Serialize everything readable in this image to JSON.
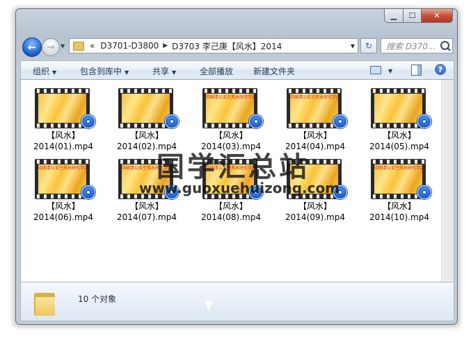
{
  "breadcrumb": {
    "prefix": "«",
    "parent": "D3701-D3800",
    "current": "D3703 李己庚【风水】2014"
  },
  "search": {
    "placeholder": "搜索 D370..."
  },
  "toolbar": {
    "organize": "组织",
    "include_library": "包含到库中",
    "share": "共享",
    "play_all": "全部播放",
    "new_folder": "新建文件夹"
  },
  "files": [
    {
      "line1": "【风水】",
      "line2": "2014(01).mp4",
      "thumb_text": ""
    },
    {
      "line1": "【风水】",
      "line2": "2014(02).mp4",
      "thumb_text": ""
    },
    {
      "line1": "【风水】",
      "line2": "2014(03).mp4",
      "thumb_text": "中国清公玄空风水研究学会"
    },
    {
      "line1": "【风水】",
      "line2": "2014(04).mp4",
      "thumb_text": "中国清公玄空风水研究学会"
    },
    {
      "line1": "【风水】",
      "line2": "2014(05).mp4",
      "thumb_text": ""
    },
    {
      "line1": "【风水】",
      "line2": "2014(06).mp4",
      "thumb_text": "中国清公玄空风水研究学会"
    },
    {
      "line1": "【风水】",
      "line2": "2014(07).mp4",
      "thumb_text": "中国清公玄空风水研究学会"
    },
    {
      "line1": "【风水】",
      "line2": "2014(08).mp4",
      "thumb_text": "中国清公玄空风水研究学会"
    },
    {
      "line1": "【风水】",
      "line2": "2014(09).mp4",
      "thumb_text": ""
    },
    {
      "line1": "【风水】",
      "line2": "2014(10).mp4",
      "thumb_text": "中国清公玄空风水研究学会"
    }
  ],
  "status": {
    "count": "10 个对象"
  },
  "watermark": {
    "line1": "国学汇总站",
    "line2": "www.guoxuehuizong.com"
  }
}
